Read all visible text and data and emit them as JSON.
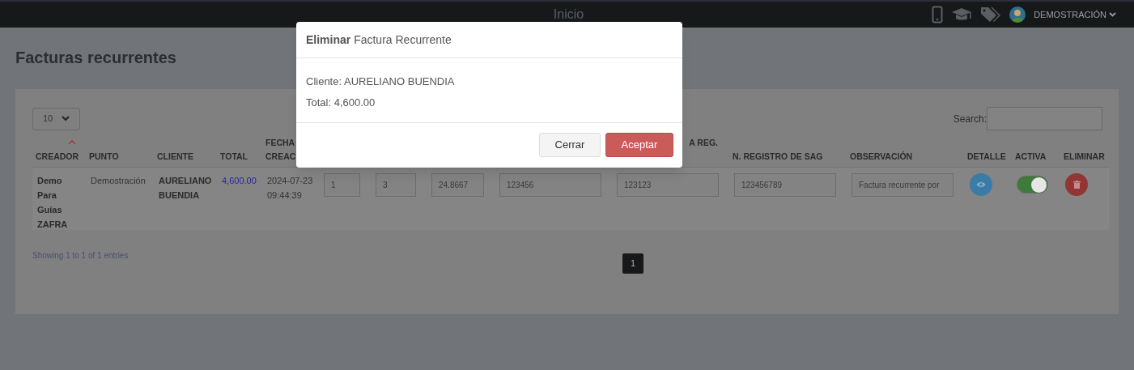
{
  "topbar": {
    "title": "Inicio",
    "user": "DEMOSTRACIÓN"
  },
  "page": {
    "title": "Facturas recurrentes"
  },
  "table_controls": {
    "page_size": "10",
    "search_label": "Search:"
  },
  "table": {
    "columns": [
      {
        "label": "CREADOR",
        "sorted": true
      },
      {
        "label": "PUNTO",
        "sorted": false
      },
      {
        "label": "CLIENTE",
        "sorted": false
      },
      {
        "label": "TOTAL",
        "sorted": false
      },
      {
        "label": "FECHA CREAC"
      },
      {},
      {},
      {},
      {},
      {
        "label": "A REG.",
        "sorted": false,
        "right_aligned": true
      },
      {
        "label": "N. REGISTRO DE SAG",
        "sorted": false
      },
      {
        "label": "OBSERVACIÓN",
        "sorted": false
      },
      {
        "label": "DETALLE",
        "sorted": false
      },
      {
        "label": "ACTIVA",
        "sorted": false
      },
      {
        "label": "ELIMINAR",
        "sorted": false
      }
    ],
    "rows": [
      {
        "cells": [
          {
            "kind": "bold",
            "text": "Demo Para Guías ZAFRA"
          },
          {
            "kind": "text",
            "text": "Demostración"
          },
          {
            "kind": "bold",
            "text": "AURELIANO BUENDIA"
          },
          {
            "kind": "link",
            "text": "4,600.00"
          },
          {
            "kind": "text",
            "text": "2024-07-23 09:44:39"
          },
          {
            "kind": "input",
            "text": "1"
          },
          {
            "kind": "input",
            "text": "3"
          },
          {
            "kind": "input",
            "text": "24.8667"
          },
          {
            "kind": "input",
            "text": "123456"
          },
          {
            "kind": "input",
            "text": "123123"
          },
          {
            "kind": "input",
            "text": "123456789"
          },
          {
            "kind": "input",
            "text": "Factura recurrente por"
          },
          {
            "kind": "view"
          },
          {
            "kind": "toggle",
            "on": true
          },
          {
            "kind": "delete"
          }
        ]
      }
    ]
  },
  "table_footer": {
    "info": "Showing 1 to 1 of 1 entries",
    "pages": [
      {
        "label": "1",
        "selected": true
      }
    ]
  },
  "modal": {
    "title": "**Eliminar** Factura Recurrente",
    "lines": [
      "Cliente: AURELIANO BUENDIA",
      "Total: 4,600.00"
    ],
    "buttons": [
      {
        "label": "Cerrar",
        "kind": "default"
      },
      {
        "label": "Aceptar",
        "kind": "danger"
      }
    ]
  }
}
